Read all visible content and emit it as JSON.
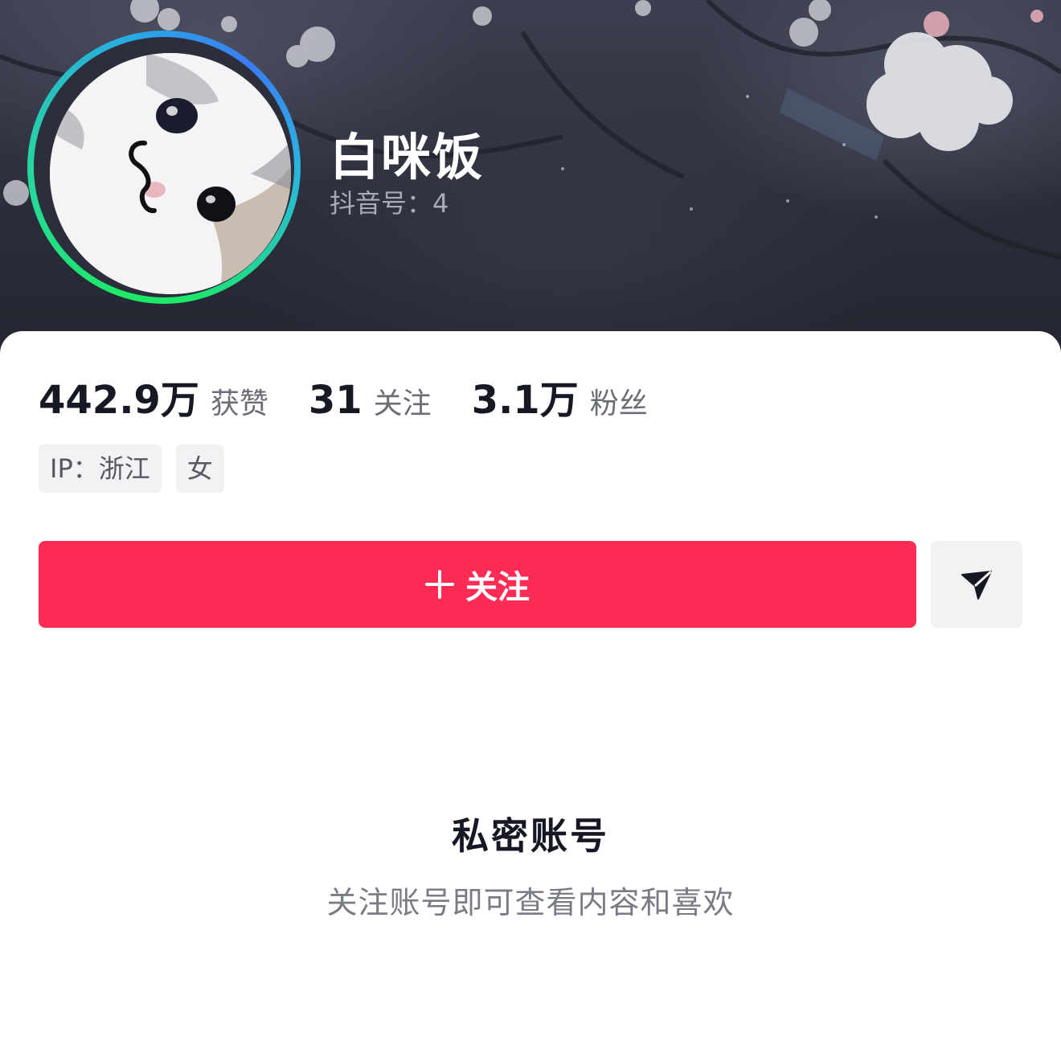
{
  "profile": {
    "nickname": "白咪饭",
    "account_id": "抖音号：4",
    "avatar_description_icon": "cat-avatar"
  },
  "stats": [
    {
      "value": "442.9万",
      "label": "获赞"
    },
    {
      "value": "31",
      "label": "关注"
    },
    {
      "value": "3.1万",
      "label": "粉丝"
    }
  ],
  "tags": [
    "IP：浙江",
    "女"
  ],
  "actions": {
    "follow_label": "关注",
    "follow_icon": "plus-icon",
    "message_icon": "send-icon"
  },
  "private_notice": {
    "title": "私密账号",
    "hint": "关注账号即可查看内容和喜欢"
  },
  "colors": {
    "accent": "#fe2c55",
    "text_primary": "#161823",
    "text_secondary": "#6b6d76",
    "banner_dark": "#2b2d3a"
  }
}
